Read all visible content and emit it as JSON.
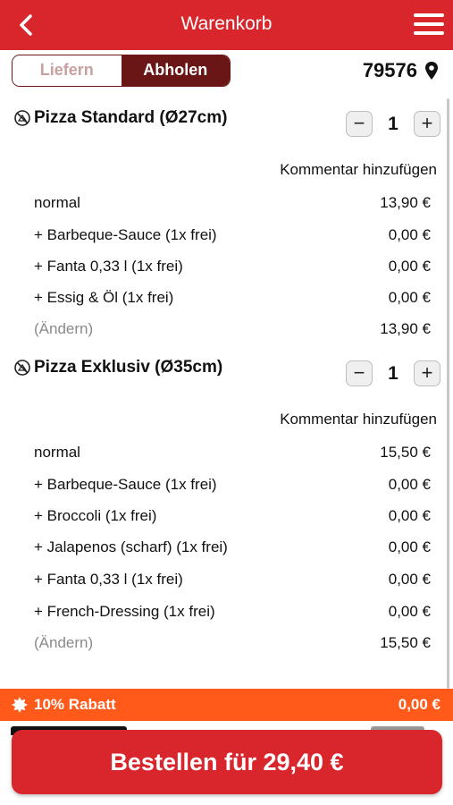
{
  "header": {
    "title": "Warenkorb",
    "back_icon": "chevron-left-icon",
    "menu_icon": "hamburger-menu-icon"
  },
  "delivery_toggle": {
    "options": [
      "Liefern",
      "Abholen"
    ],
    "selected": "Abholen"
  },
  "location": {
    "zip": "79576",
    "icon": "location-pin-icon"
  },
  "colors": {
    "header": "#d8262c",
    "toggle_active": "#6b1616",
    "discount_bar": "#ff5a1a",
    "order_button": "#d8262c"
  },
  "cart": {
    "items": [
      {
        "name": "Pizza Standard (Ø27cm)",
        "quantity": "1",
        "comment_label": "Kommentar hinzufügen",
        "lines": [
          {
            "label": "normal",
            "price": "13,90 €"
          },
          {
            "label": "+ Barbeque-Sauce (1x frei)",
            "price": "0,00 €"
          },
          {
            "label": "+ Fanta 0,33 l (1x frei)",
            "price": "0,00 €"
          },
          {
            "label": "+ Essig & Öl (1x frei)",
            "price": "0,00 €"
          }
        ],
        "edit_label": "(Ändern)",
        "total": "13,90 €"
      },
      {
        "name": "Pizza Exklusiv (Ø35cm)",
        "quantity": "1",
        "comment_label": "Kommentar hinzufügen",
        "lines": [
          {
            "label": "normal",
            "price": "15,50 €"
          },
          {
            "label": "+ Barbeque-Sauce (1x frei)",
            "price": "0,00 €"
          },
          {
            "label": "+ Broccoli (1x frei)",
            "price": "0,00 €"
          },
          {
            "label": "+ Jalapenos (scharf) (1x frei)",
            "price": "0,00 €"
          },
          {
            "label": "+ Fanta 0,33 l (1x frei)",
            "price": "0,00 €"
          },
          {
            "label": "+ French-Dressing (1x frei)",
            "price": "0,00 €"
          }
        ],
        "edit_label": "(Ändern)",
        "total": "15,50 €"
      }
    ],
    "qty_minus": "−",
    "qty_plus": "+"
  },
  "discount": {
    "label": "10% Rabatt",
    "value": "0,00 €"
  },
  "order_button": {
    "label": "Bestellen für 29,40 €"
  }
}
